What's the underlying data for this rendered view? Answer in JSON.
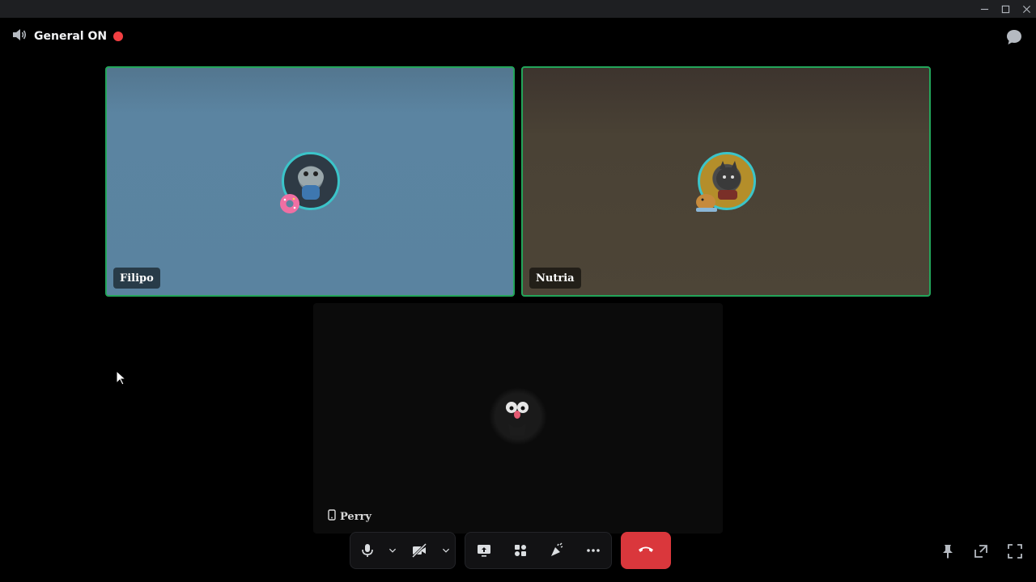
{
  "window": {
    "controls": [
      "minimize-icon",
      "maximize-icon",
      "close-icon"
    ]
  },
  "channel": {
    "name": "General ON",
    "icon": "speaker-icon",
    "live_color": "#f23f42"
  },
  "participants": [
    {
      "name": "Filipo",
      "speaking": true,
      "bg": "#5a83a0",
      "avatar": "toad-with-donut-avatar"
    },
    {
      "name": "Nutria",
      "speaking": true,
      "bg": "#4a4235",
      "avatar": "rat-with-capybara-avatar"
    },
    {
      "name": "Perry",
      "speaking": false,
      "bg": "#0b0b0b",
      "avatar": "dark-creature-avatar",
      "device_icon": "mobile-phone-icon"
    }
  ],
  "controls": {
    "left_group": [
      "microphone-icon",
      "chevron-down-icon",
      "camera-off-icon",
      "chevron-down-icon"
    ],
    "middle_group": [
      "screen-share-icon",
      "activities-icon",
      "soundboard-icon",
      "more-icon"
    ],
    "leave_icon": "hang-up-icon",
    "leave_color": "#da373c",
    "right": [
      "pin-icon",
      "pop-out-icon",
      "fullscreen-icon"
    ]
  },
  "accent": {
    "speaking_border": "#23a55a",
    "avatar_ring": "#3bc4c9"
  }
}
